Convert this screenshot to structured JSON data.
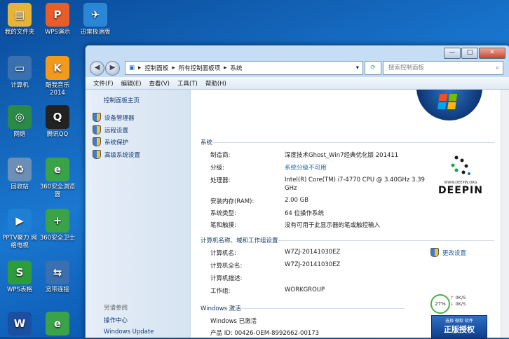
{
  "desktop": {
    "icons": [
      {
        "label": "我的文件夹",
        "color": "#e7b43a"
      },
      {
        "label": "WPS演示",
        "color": "#e85d2a"
      },
      {
        "label": "迅雷极速版",
        "color": "#2c86d6"
      },
      {
        "label": "计算机",
        "color": "#3a6fb0"
      },
      {
        "label": "酷我音乐\n2014",
        "color": "#f29a1c"
      },
      {
        "label": "网络",
        "color": "#2b8a4a"
      },
      {
        "label": "腾讯QQ",
        "color": "#222222"
      },
      {
        "label": "回收站",
        "color": "#6c8fb8"
      },
      {
        "label": "360安全浏览器",
        "color": "#3aa34a"
      },
      {
        "label": "PPTV聚力 网络电视",
        "color": "#1f7fd3"
      },
      {
        "label": "360安全卫士",
        "color": "#3aa34a"
      },
      {
        "label": "WPS表格",
        "color": "#2e9c3c"
      },
      {
        "label": "宽带连接",
        "color": "#3a6fb0"
      },
      {
        "label": "",
        "color": "#1d4fa0"
      },
      {
        "label": "",
        "color": "#3aa34a"
      }
    ]
  },
  "window": {
    "buttons": {
      "minimize": "—",
      "maximize": "□",
      "close": "✕"
    },
    "breadcrumb": [
      "控制面板",
      "所有控制面板项",
      "系统"
    ],
    "search_placeholder": "搜索控制面板",
    "menu": [
      "文件(F)",
      "编辑(E)",
      "查看(V)",
      "工具(T)",
      "帮助(H)"
    ],
    "left_pane": {
      "home": "控制面板主页",
      "items": [
        "设备管理器",
        "远程设置",
        "系统保护",
        "高级系统设置"
      ],
      "see_also": "另请参阅",
      "see_also_items": [
        "操作中心",
        "Windows Update"
      ]
    },
    "system": {
      "heading": "系统",
      "rows": [
        {
          "label": "制造商:",
          "value": "深度技术Ghost_Win7经典优化版 201411"
        },
        {
          "label": "分级:",
          "value": "系统分级不可用"
        },
        {
          "label": "处理器:",
          "value": "Intel(R) Core(TM) i7-4770 CPU @ 3.40GHz   3.39 GHz"
        },
        {
          "label": "安装内存(RAM):",
          "value": "2.00 GB"
        },
        {
          "label": "系统类型:",
          "value": "64 位操作系统"
        },
        {
          "label": "笔和触摸:",
          "value": "没有可用于此显示器的笔或触控输入"
        }
      ],
      "logo_url": "WWW.DEEPIN.ORG",
      "logo_text": "DEEPIN"
    },
    "computer": {
      "heading": "计算机名称、域和工作组设置",
      "change_settings": "更改设置",
      "rows": [
        {
          "label": "计算机名:",
          "value": "W7ZJ-20141030EZ"
        },
        {
          "label": "计算机全名:",
          "value": "W7ZJ-20141030EZ"
        },
        {
          "label": "计算机描述:",
          "value": ""
        },
        {
          "label": "工作组:",
          "value": "WORKGROUP"
        }
      ]
    },
    "activation": {
      "heading": "Windows 激活",
      "status": "Windows 已激活",
      "product_id": "产品 ID: 00426-OEM-8992662-00173"
    },
    "widget": {
      "percent": "27%",
      "up": "0K/S",
      "down": "0K/S",
      "badge_small": "选择 微软 软件",
      "badge_big": "正版授权"
    }
  }
}
